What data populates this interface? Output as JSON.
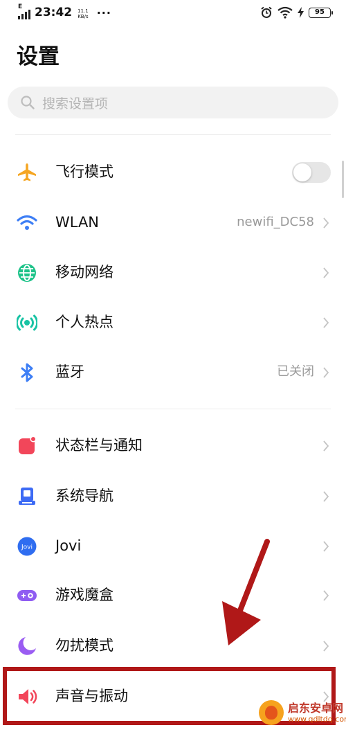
{
  "status_bar": {
    "network": "E",
    "time": "23:42",
    "speed_value": "11.1",
    "speed_unit": "KB/s",
    "more": "···",
    "battery": "95"
  },
  "page": {
    "title": "设置"
  },
  "search": {
    "placeholder": "搜索设置项"
  },
  "items": [
    {
      "label": "飞行模式",
      "icon": "airplane-icon",
      "toggle_on": false
    },
    {
      "label": "WLAN",
      "value": "newifi_DC58",
      "icon": "wifi-icon"
    },
    {
      "label": "移动网络",
      "icon": "globe-icon"
    },
    {
      "label": "个人热点",
      "icon": "hotspot-icon"
    },
    {
      "label": "蓝牙",
      "value": "已关闭",
      "icon": "bluetooth-icon"
    },
    {
      "label": "状态栏与通知",
      "icon": "notification-icon"
    },
    {
      "label": "系统导航",
      "icon": "navigation-icon"
    },
    {
      "label": "Jovi",
      "icon": "jovi-icon",
      "icon_text": "Jovi"
    },
    {
      "label": "游戏魔盒",
      "icon": "game-box-icon"
    },
    {
      "label": "勿扰模式",
      "icon": "moon-icon"
    },
    {
      "label": "声音与振动",
      "icon": "speaker-icon"
    }
  ],
  "watermark": {
    "line1": "启东安卓网",
    "line2": "www.qdltdq.com"
  },
  "colors": {
    "airplane": "#f5a623",
    "wifi": "#3d7ef5",
    "globe": "#1fc38a",
    "hotspot": "#18c3a4",
    "bluetooth": "#3d7ef5",
    "notification": "#f2465a",
    "navigation": "#3d6bf5",
    "jovi": "#2f6df0",
    "game": "#8f5cf2",
    "moon": "#9a5cf2",
    "speaker": "#f2465a",
    "annotation": "#b01818"
  }
}
